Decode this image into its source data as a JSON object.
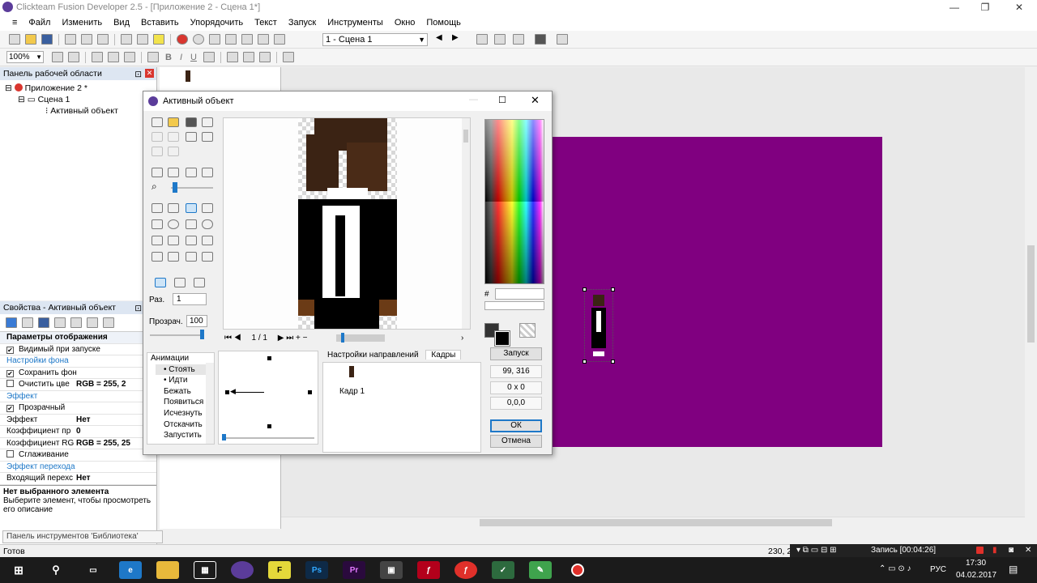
{
  "window": {
    "title": "Clickteam Fusion Developer 2.5 - [Приложение 2 - Сцена 1*]"
  },
  "menu": [
    "Файл",
    "Изменить",
    "Вид",
    "Вставить",
    "Упорядочить",
    "Текст",
    "Запуск",
    "Инструменты",
    "Окно",
    "Помощь"
  ],
  "toolbar": {
    "scene_select": "1 - Сцена 1",
    "zoom": "100%"
  },
  "workspace": {
    "title": "Панель рабочей области",
    "tree": [
      "Приложение 2 *",
      "Сцена 1",
      "Активный объект"
    ]
  },
  "properties": {
    "title": "Свойства - Активный объект",
    "rows": [
      {
        "label": "Параметры отображения",
        "type": "header"
      },
      {
        "label": "Видимый при запуске",
        "type": "check",
        "checked": "✔"
      },
      {
        "label": "Настройки фона",
        "type": "cat"
      },
      {
        "label": "Сохранить фон",
        "type": "check",
        "checked": "✔"
      },
      {
        "label": "Очистить цве",
        "type": "check",
        "checked": "",
        "value": "RGB = 255, 2"
      },
      {
        "label": "Эффект",
        "type": "cat"
      },
      {
        "label": "Прозрачный",
        "type": "check",
        "checked": "✔"
      },
      {
        "label": "Эффект",
        "type": "val",
        "value": "Нет"
      },
      {
        "label": "Коэффициент пр",
        "type": "val",
        "value": "0"
      },
      {
        "label": "Коэффициент RG",
        "type": "val",
        "value": "RGB = 255, 25"
      },
      {
        "label": "Сглаживание",
        "type": "check",
        "checked": ""
      },
      {
        "label": "Эффект перехода",
        "type": "cat"
      },
      {
        "label": "Входящий перехс",
        "type": "val",
        "value": "Нет"
      }
    ],
    "desc_title": "Нет выбранного элемента",
    "desc_text": "Выберите элемент, чтобы просмотреть его описание"
  },
  "library_tab": "Панель инструментов 'Библиотека'",
  "status": {
    "left": "Готов",
    "coords": "230, 2"
  },
  "recorder": "Запись [00:04:26]",
  "dialog": {
    "title": "Активный объект",
    "size_label": "Раз.",
    "size_value": "1",
    "opacity_label": "Прозрач.",
    "opacity_value": "100",
    "frame_counter": "1 / 1",
    "animations_header": "Анимации",
    "animations": [
      "• Стоять",
      "• Идти",
      "Бежать",
      "Появиться",
      "Исчезнуть",
      "Отскачить",
      "Запустить"
    ],
    "tabs": [
      "Настройки направлений",
      "Кадры"
    ],
    "frame_label": "Кадр 1",
    "hash": "#",
    "run_button": "Запуск",
    "hotspot": "99, 316",
    "dimensions": "0 x 0",
    "action_point": "0,0,0",
    "ok": "ОК",
    "cancel": "Отмена"
  },
  "tray": {
    "lang": "РУС",
    "time": "17:30",
    "date": "04.02.2017"
  },
  "colors": {
    "frame_bg": "#800080",
    "accent": "#1e78c8"
  }
}
